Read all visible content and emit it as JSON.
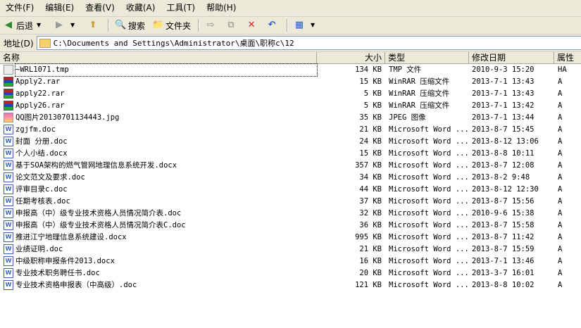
{
  "menu": [
    "文件(F)",
    "编辑(E)",
    "查看(V)",
    "收藏(A)",
    "工具(T)",
    "帮助(H)"
  ],
  "toolbar": {
    "back": "后退",
    "search": "搜索",
    "folders": "文件夹"
  },
  "address": {
    "label": "地址(D)",
    "path": "C:\\Documents and Settings\\Administrator\\桌面\\职称c\\12"
  },
  "columns": {
    "name": "名称",
    "size": "大小",
    "type": "类型",
    "date": "修改日期",
    "attr": "属性"
  },
  "files": [
    {
      "name": "~WRL1071.tmp",
      "size": "134 KB",
      "type": "TMP 文件",
      "date": "2010-9-3 15:20",
      "attr": "HA",
      "icon": "tmp"
    },
    {
      "name": "Apply2.rar",
      "size": "15 KB",
      "type": "WinRAR 压缩文件",
      "date": "2013-7-1 13:43",
      "attr": "A",
      "icon": "rar"
    },
    {
      "name": "apply22.rar",
      "size": "5 KB",
      "type": "WinRAR 压缩文件",
      "date": "2013-7-1 13:43",
      "attr": "A",
      "icon": "rar"
    },
    {
      "name": "Apply26.rar",
      "size": "5 KB",
      "type": "WinRAR 压缩文件",
      "date": "2013-7-1 13:42",
      "attr": "A",
      "icon": "rar"
    },
    {
      "name": "QQ图片20130701134443.jpg",
      "size": "35 KB",
      "type": "JPEG 图像",
      "date": "2013-7-1 13:44",
      "attr": "A",
      "icon": "jpg"
    },
    {
      "name": "zgjfm.doc",
      "size": "21 KB",
      "type": "Microsoft Word ...",
      "date": "2013-8-7 15:45",
      "attr": "A",
      "icon": "doc"
    },
    {
      "name": "封面 分册.doc",
      "size": "24 KB",
      "type": "Microsoft Word ...",
      "date": "2013-8-12 13:06",
      "attr": "A",
      "icon": "doc"
    },
    {
      "name": "个人小结.docx",
      "size": "15 KB",
      "type": "Microsoft Word ...",
      "date": "2013-8-8 10:11",
      "attr": "A",
      "icon": "doc"
    },
    {
      "name": "基于SOA架构的燃气管网地理信息系统开发.docx",
      "size": "357 KB",
      "type": "Microsoft Word ...",
      "date": "2013-8-7 12:08",
      "attr": "A",
      "icon": "doc"
    },
    {
      "name": "论文范文及要求.doc",
      "size": "34 KB",
      "type": "Microsoft Word ...",
      "date": "2013-8-2 9:48",
      "attr": "A",
      "icon": "doc"
    },
    {
      "name": "评审目录c.doc",
      "size": "44 KB",
      "type": "Microsoft Word ...",
      "date": "2013-8-12 12:30",
      "attr": "A",
      "icon": "doc"
    },
    {
      "name": "任期考核表.doc",
      "size": "37 KB",
      "type": "Microsoft Word ...",
      "date": "2013-8-7 15:56",
      "attr": "A",
      "icon": "doc"
    },
    {
      "name": "申报高（中）级专业技术资格人员情况简介表.doc",
      "size": "32 KB",
      "type": "Microsoft Word ...",
      "date": "2010-9-6 15:38",
      "attr": "A",
      "icon": "doc"
    },
    {
      "name": "申报高（中）级专业技术资格人员情况简介表C.doc",
      "size": "36 KB",
      "type": "Microsoft Word ...",
      "date": "2013-8-7 15:58",
      "attr": "A",
      "icon": "doc"
    },
    {
      "name": "推进江宁地理信息系统建设.docx",
      "size": "995 KB",
      "type": "Microsoft Word ...",
      "date": "2013-8-7 11:42",
      "attr": "A",
      "icon": "doc"
    },
    {
      "name": "业绩证明.doc",
      "size": "21 KB",
      "type": "Microsoft Word ...",
      "date": "2013-8-7 15:59",
      "attr": "A",
      "icon": "doc"
    },
    {
      "name": "中级职称申报条件2013.docx",
      "size": "16 KB",
      "type": "Microsoft Word ...",
      "date": "2013-7-1 13:46",
      "attr": "A",
      "icon": "doc"
    },
    {
      "name": "专业技术职务聘任书.doc",
      "size": "20 KB",
      "type": "Microsoft Word ...",
      "date": "2013-3-7 16:01",
      "attr": "A",
      "icon": "doc"
    },
    {
      "name": "专业技术资格申报表（中高级）.doc",
      "size": "121 KB",
      "type": "Microsoft Word ...",
      "date": "2013-8-8 10:02",
      "attr": "A",
      "icon": "doc"
    }
  ]
}
